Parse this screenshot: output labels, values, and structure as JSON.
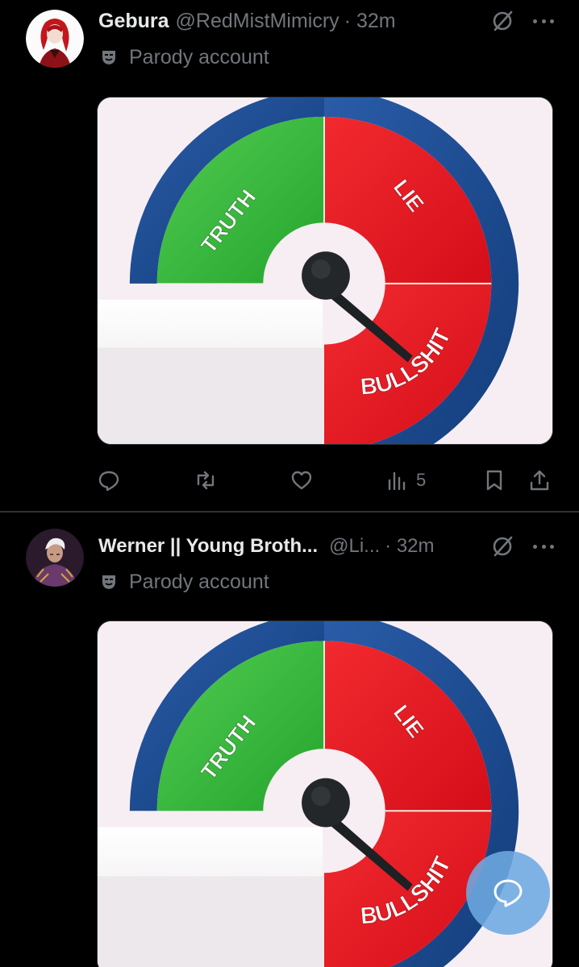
{
  "posts": [
    {
      "author_name": "Gebura",
      "author_handle": "@RedMistMimicry",
      "time": "· 32m",
      "badge_label": "Parody account",
      "meter": {
        "truth": "TRUTH",
        "lie": "LIE",
        "bullshit": "BULLSHIT"
      },
      "stats": {
        "views": "5"
      }
    },
    {
      "author_name": "Werner || Young Broth...",
      "author_handle": "@Li...",
      "time": "· 32m",
      "badge_label": "Parody account",
      "meter": {
        "truth": "TRUTH",
        "lie": "LIE",
        "bullshit": "BULLSHIT"
      }
    }
  ],
  "icons": {
    "avatar_1": "red-haired-character-avatar",
    "avatar_2": "white-haired-character-avatar",
    "grok": "grok-icon",
    "more": "more-icon",
    "parody": "theater-mask-icon",
    "reply": "reply-icon",
    "repost": "repost-icon",
    "like": "heart-icon",
    "views": "views-icon",
    "bookmark": "bookmark-icon",
    "share": "share-icon",
    "compose": "compose-reply-icon"
  },
  "colors": {
    "background": "#000000",
    "text_primary": "#e7e9ea",
    "text_secondary": "#71767b",
    "divider": "#2f3336",
    "meter_truth": "#37b63d",
    "meter_lie": "#e8151f",
    "meter_rim": "#1b4e94",
    "fab": "#6eaae1"
  }
}
